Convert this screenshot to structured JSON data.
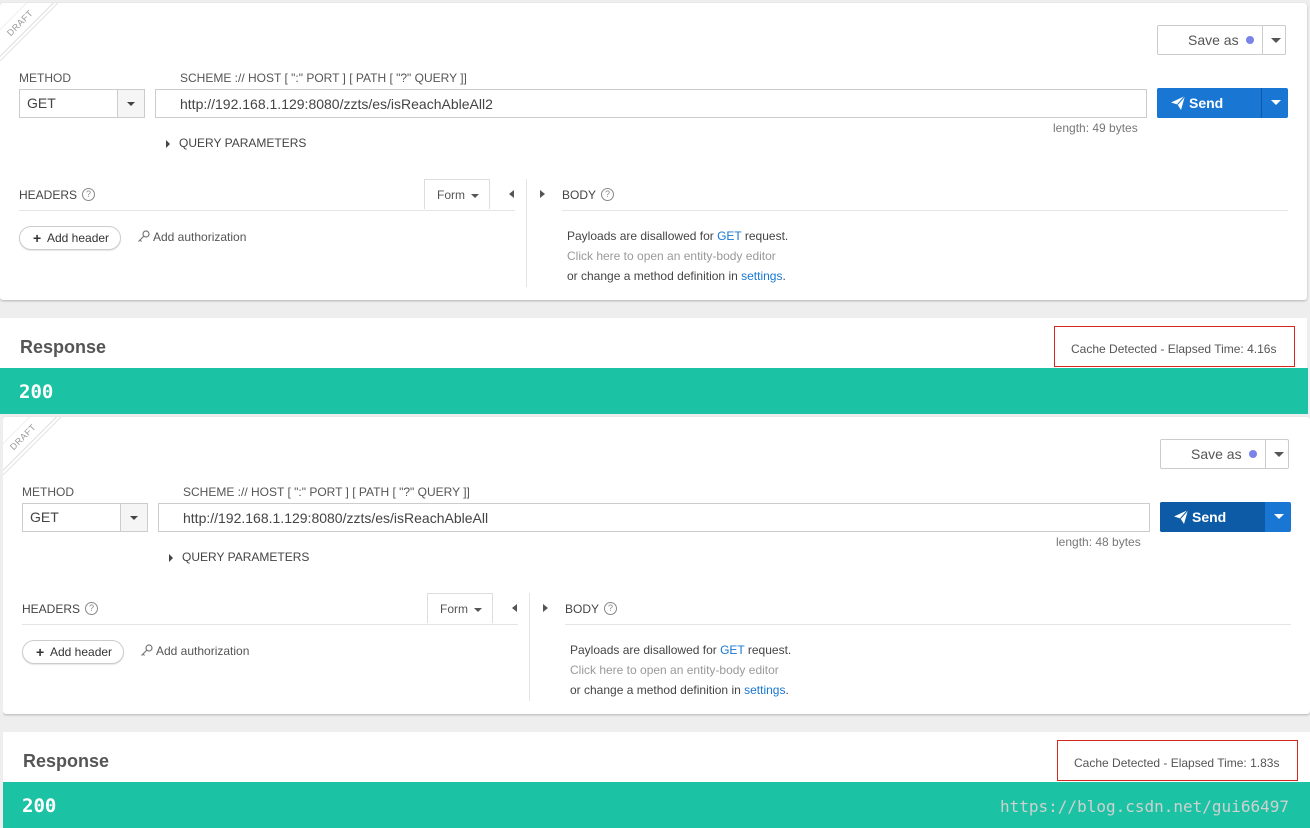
{
  "panels": [
    {
      "draft_label": "DRAFT",
      "save_as_label": "Save as",
      "method_label": "METHOD",
      "url_label": "SCHEME :// HOST [ \":\" PORT ] [ PATH [ \"?\" QUERY ]]",
      "method_value": "GET",
      "url_value": "http://192.168.1.129:8080/zzts/es/isReachAbleAll2",
      "length_text": "length: 49 bytes",
      "send_label": "Send",
      "query_params_label": "QUERY PARAMETERS",
      "headers_label": "HEADERS",
      "form_label": "Form",
      "add_header_label": "Add header",
      "add_auth_label": "Add authorization",
      "body_label": "BODY",
      "body_line1_pre": "Payloads are disallowed for ",
      "body_line1_link": "GET",
      "body_line1_post": " request.",
      "body_line2": "Click here to open an entity-body editor",
      "body_line3_pre": "or change a method definition in ",
      "body_line3_link": "settings",
      "body_line3_post": ".",
      "response_title": "Response",
      "cache_text": "Cache Detected - Elapsed Time: 4.16s",
      "status_code": "200"
    },
    {
      "draft_label": "DRAFT",
      "save_as_label": "Save as",
      "method_label": "METHOD",
      "url_label": "SCHEME :// HOST [ \":\" PORT ] [ PATH [ \"?\" QUERY ]]",
      "method_value": "GET",
      "url_value": "http://192.168.1.129:8080/zzts/es/isReachAbleAll",
      "length_text": "length: 48 bytes",
      "send_label": "Send",
      "query_params_label": "QUERY PARAMETERS",
      "headers_label": "HEADERS",
      "form_label": "Form",
      "add_header_label": "Add header",
      "add_auth_label": "Add authorization",
      "body_label": "BODY",
      "body_line1_pre": "Payloads are disallowed for ",
      "body_line1_link": "GET",
      "body_line1_post": " request.",
      "body_line2": "Click here to open an entity-body editor",
      "body_line3_pre": "or change a method definition in ",
      "body_line3_link": "settings",
      "body_line3_post": ".",
      "response_title": "Response",
      "cache_text": "Cache Detected - Elapsed Time: 1.83s",
      "status_code": "200"
    }
  ],
  "watermark": "https://blog.csdn.net/gui66497",
  "colors": {
    "send_button": "#1976d2",
    "status_ok": "#1bc3a4",
    "highlight_box": "#d9261c",
    "link": "#1976d2"
  }
}
